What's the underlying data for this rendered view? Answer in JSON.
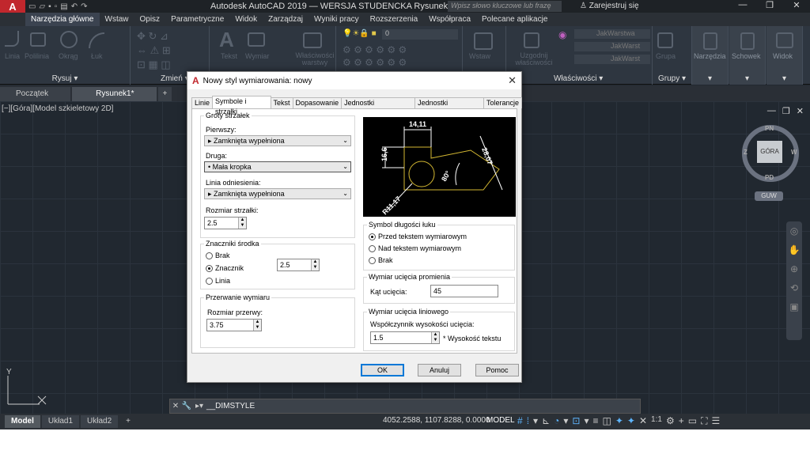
{
  "titlebar": {
    "app_title": "Autodesk AutoCAD 2019 — WERSJA STUDENCKA    Rysunek1.dwg",
    "search_placeholder": "Wpisz słowo kluczowe lub frazę",
    "signin": "Zarejestruj się",
    "logo": "A"
  },
  "ribbon_tabs": [
    "Narzędzia główne",
    "Wstaw",
    "Opisz",
    "Parametryczne",
    "Widok",
    "Zarządzaj",
    "Wyniki pracy",
    "Rozszerzenia",
    "Współpraca",
    "Polecane aplikacje"
  ],
  "ribbon_groups": {
    "draw_tools": [
      "Linia",
      "Polilinia",
      "Okrąg",
      "Łuk"
    ],
    "text_tools": [
      "Tekst",
      "Wymiar"
    ],
    "props_tool": "Właściwości warstwy",
    "layer_value": "0",
    "insert_tool": "Wstaw",
    "match_tool": "Uzgodnij właściwości",
    "jak_warstwa_1": "JakWarstwa",
    "jak_warstwa_2": "JakWarst",
    "jak_warstwa_3": "JakWarst",
    "group_tool": "Grupa",
    "calc_tool": "Narzędzia",
    "clipboard_tool": "Schowek",
    "view_tool": "Widok",
    "rysuj": "Rysuj",
    "zmien": "Zmień",
    "wlasciwosci": "Właściwości",
    "grupy": "Grupy"
  },
  "doc_tabs": [
    "Początek",
    "Rysunek1*"
  ],
  "viewport": {
    "label": "[−][Góra][Model szkieletowy 2D]",
    "cube_label": "GÓRA",
    "dir_n": "PN",
    "dir_s": "PD",
    "dir_w": "Z",
    "dir_e": "W",
    "wcs": "GUW",
    "ucs_y": "Y"
  },
  "command_line": {
    "text": "_DIMSTYLE"
  },
  "status": {
    "layout_tabs": [
      "Model",
      "Układ1",
      "Układ2"
    ],
    "add_tab": "+",
    "coords": "4052.2588, 1107.8288, 0.0000",
    "model": "MODEL",
    "scale": "1:1"
  },
  "dialog": {
    "title": "Nowy styl wymiarowania: nowy",
    "tabs": [
      "Linie",
      "Symbole i strzałki",
      "Tekst",
      "Dopasowanie",
      "Jednostki podstawowe",
      "Jednostki dodatkowe",
      "Tolerancje"
    ],
    "arrowheads": {
      "legend": "Groty strzałek",
      "first_label": "Pierwszy:",
      "first_value": "Zamknięta wypełniona",
      "second_label": "Druga:",
      "second_value": "Mała kropka",
      "leader_label": "Linia odniesienia:",
      "leader_value": "Zamknięta wypełniona",
      "size_label": "Rozmiar strzałki:",
      "size_value": "2.5"
    },
    "center_marks": {
      "legend": "Znaczniki środka",
      "options": [
        "Brak",
        "Znacznik",
        "Linia"
      ],
      "selected": "Znacznik",
      "value": "2.5"
    },
    "dim_break": {
      "legend": "Przerwanie wymiaru",
      "size_label": "Rozmiar przerwy:",
      "size_value": "3.75"
    },
    "arc_length": {
      "legend": "Symbol długości łuku",
      "options": [
        "Przed tekstem wymiarowym",
        "Nad tekstem wymiarowym",
        "Brak"
      ],
      "selected": "Przed tekstem wymiarowym"
    },
    "radius_jog": {
      "legend": "Wymiar ucięcia promienia",
      "angle_label": "Kąt ucięcia:",
      "angle_value": "45"
    },
    "linear_jog": {
      "legend": "Wymiar ucięcia liniowego",
      "factor_label": "Współczynnik wysokości ucięcia:",
      "factor_value": "1.5",
      "suffix": "* Wysokość tekstu"
    },
    "preview": {
      "dim_top": "14,11",
      "dim_left": "16,6",
      "dim_diag": "28,07",
      "dim_angle": "80°",
      "dim_radius": "R11,17"
    },
    "buttons": {
      "ok": "OK",
      "cancel": "Anuluj",
      "help": "Pomoc"
    }
  },
  "colors": {
    "accent": "#0078d7",
    "brand": "#c1272d",
    "preview_line": "#d4b832",
    "preview_text": "#ffffff"
  }
}
